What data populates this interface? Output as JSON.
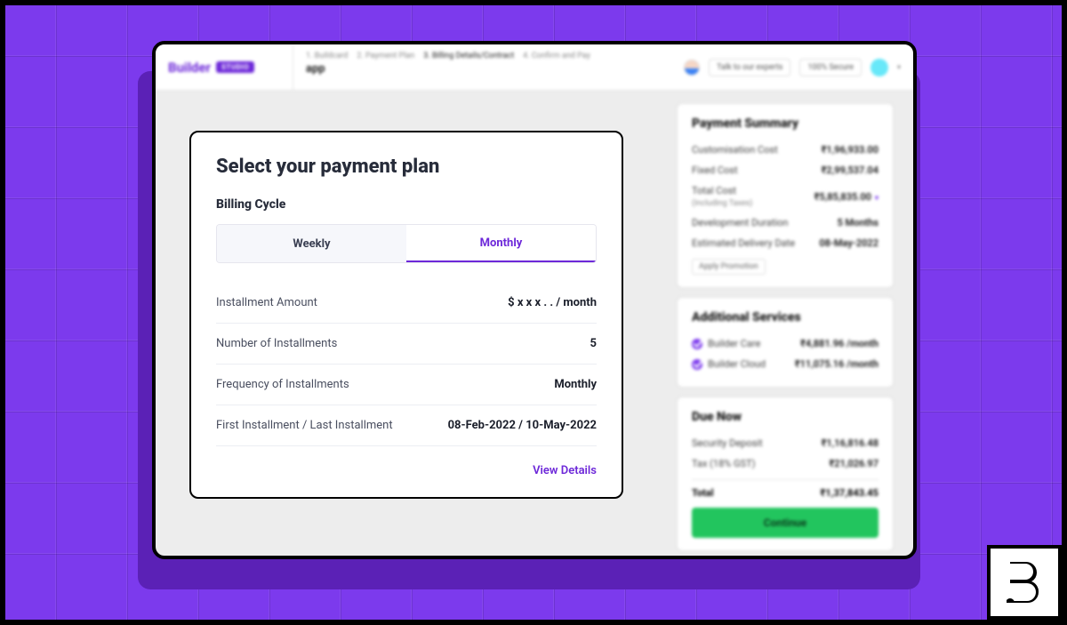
{
  "brand": {
    "name": "Builder",
    "badge": "STUDIO"
  },
  "breadcrumbs": {
    "steps": [
      "1. Buildcard",
      "2. Payment Plan",
      "3. Billing Details/Contract",
      "4. Confirm and Pay"
    ],
    "active_index": 2,
    "page_title": "app"
  },
  "top_actions": {
    "experts": "Talk to our experts",
    "secure": "100% Secure"
  },
  "modal": {
    "title": "Select your payment plan",
    "section": "Billing Cycle",
    "tabs": {
      "weekly": "Weekly",
      "monthly": "Monthly",
      "selected": "monthly"
    },
    "rows": {
      "installment_amount": {
        "label": "Installment Amount",
        "value": "$ x x x . . / month"
      },
      "num_installments": {
        "label": "Number of Installments",
        "value": "5"
      },
      "frequency": {
        "label": "Frequency of Installments",
        "value": "Monthly"
      },
      "first_last": {
        "label": "First Installment / Last Installment",
        "value": "08-Feb-2022 / 10-May-2022"
      }
    },
    "view_details": "View Details"
  },
  "summary": {
    "title": "Payment Summary",
    "customisation": {
      "label": "Customisation Cost",
      "value": "₹1,96,933.00"
    },
    "fixed": {
      "label": "Fixed Cost",
      "value": "₹2,99,537.04"
    },
    "total_cost": {
      "label": "Total Cost",
      "sub": "(Including Taxes)",
      "value": "₹5,85,835.00"
    },
    "duration": {
      "label": "Development Duration",
      "value": "5 Months"
    },
    "delivery": {
      "label": "Estimated Delivery Date",
      "value": "08-May-2022"
    },
    "promo": "Apply Promotion"
  },
  "services": {
    "title": "Additional Services",
    "items": [
      {
        "name": "Builder Care",
        "price": "₹4,881.96 /month"
      },
      {
        "name": "Builder Cloud",
        "price": "₹11,075.16 /month"
      }
    ]
  },
  "due": {
    "title": "Due Now",
    "deposit": {
      "label": "Security Deposit",
      "value": "₹1,16,816.48"
    },
    "tax": {
      "label": "Tax (18% GST)",
      "value": "₹21,026.97"
    },
    "total": {
      "label": "Total",
      "value": "₹1,37,843.45"
    },
    "cta": "Continue"
  }
}
